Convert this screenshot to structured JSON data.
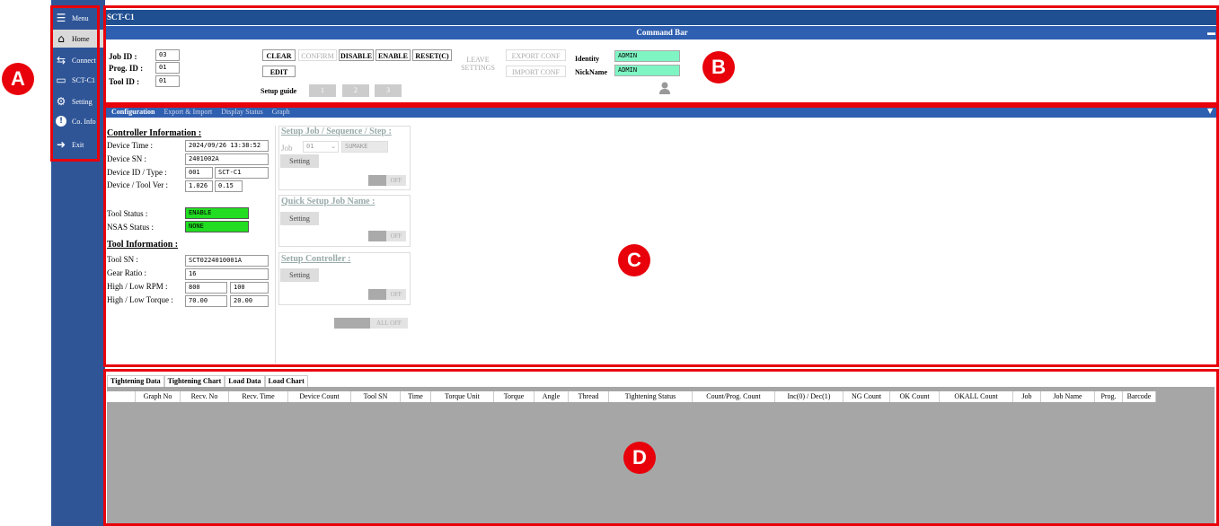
{
  "sidebar": {
    "items": [
      {
        "icon": "menu-icon",
        "glyph": "☰",
        "label": "Menu"
      },
      {
        "icon": "home-icon",
        "glyph": "⌂",
        "label": "Home"
      },
      {
        "icon": "connect-icon",
        "glyph": "⇆",
        "label": "Connect"
      },
      {
        "icon": "monitor-icon",
        "glyph": "▭",
        "label": "SCT-C1"
      },
      {
        "icon": "gear-icon",
        "glyph": "⚙",
        "label": "Setting"
      },
      {
        "icon": "info-icon",
        "glyph": "!",
        "label": "Co. Info"
      },
      {
        "icon": "exit-icon",
        "glyph": "➜",
        "label": "Exit"
      }
    ]
  },
  "title": "SCT-C1",
  "command_bar": {
    "title": "Command Bar",
    "job_id_label": "Job ID :",
    "job_id": "03",
    "prog_id_label": "Prog. ID :",
    "prog_id": "01",
    "tool_id_label": "Tool ID :",
    "tool_id": "01",
    "clear": "CLEAR",
    "confirm": "CONFIRM",
    "disable": "DISABLE",
    "enable": "ENABLE",
    "reset": "RESET(C)",
    "edit": "EDIT",
    "leave_settings_1": "LEAVE",
    "leave_settings_2": "SETTINGS",
    "export_conf": "EXPORT CONF",
    "import_conf": "IMPORT CONF",
    "identity_label": "Identity",
    "identity": "ADMIN",
    "nickname_label": "NickName",
    "nickname": "ADMIN",
    "setup_guide_label": "Setup guide",
    "guide_steps": [
      "1",
      "2",
      "3"
    ]
  },
  "main_tabs": [
    "Configuration",
    "Export & Import",
    "Display Status",
    "Graph"
  ],
  "controller": {
    "title": "Controller Information :",
    "device_time_label": "Device Time :",
    "device_time": "2024/09/26 13:38:52",
    "device_sn_label": "Device SN :",
    "device_sn": "2401002A",
    "device_id_label": "Device ID / Type :",
    "device_id": "001",
    "device_type": "SCT-C1",
    "ver_label": "Device / Tool Ver :",
    "device_ver": "1.026",
    "tool_ver": "0.15",
    "tool_status_label": "Tool Status :",
    "tool_status": "ENABLE",
    "nsas_status_label": "NSAS Status :",
    "nsas_status": "NONE"
  },
  "tool": {
    "title": "Tool Information :",
    "tool_sn_label": "Tool SN :",
    "tool_sn": "SCT0224010001A",
    "gear_ratio_label": "Gear Ratio :",
    "gear_ratio": "16",
    "rpm_label": "High / Low RPM :",
    "rpm_high": "800",
    "rpm_low": "100",
    "torque_label": "High / Low Torque :",
    "torque_high": "70.00",
    "torque_low": "20.00"
  },
  "setup": {
    "job_seq_title": "Setup Job / Sequence / Step :",
    "job_label": "Job",
    "job_value": "01",
    "job_name": "SUMAKE",
    "setting": "Setting",
    "off": "OFF",
    "quick_title": "Quick Setup Job Name :",
    "controller_title": "Setup Controller :",
    "all_off": "ALL OFF"
  },
  "data_tabs": [
    "Tightening Data",
    "Tightening Chart",
    "Load Data",
    "Load Chart"
  ],
  "table_headers": [
    "Graph No",
    "Recv. No",
    "Recv. Time",
    "Device Count",
    "Tool SN",
    "Time",
    "Torque Unit",
    "Torque",
    "Angle",
    "Thread",
    "Tightening Status",
    "Count/Prog. Count",
    "Inc(0) / Dec(1)",
    "NG Count",
    "OK Count",
    "OKALL Count",
    "Job",
    "Job Name",
    "Prog.",
    "Barcode"
  ],
  "callouts": [
    "A",
    "B",
    "C",
    "D"
  ],
  "colors": {
    "sidebar": "#2f5597",
    "title_bar": "#1f4e91",
    "command_bar": "#2f5fb0",
    "annotation_red": "#e8000b",
    "status_green": "#22dd22",
    "identity_mint": "#7ff5c4",
    "table_body": "#a6a6a6"
  }
}
